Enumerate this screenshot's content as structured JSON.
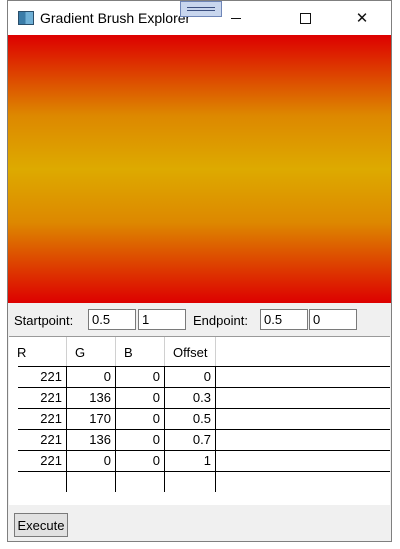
{
  "window": {
    "title": "Gradient Brush Explorer",
    "controls": {
      "minimize": "—",
      "maximize": "☐",
      "close": "✕"
    }
  },
  "gradient": {
    "stops": [
      {
        "color": "#dd0000",
        "offset": 0
      },
      {
        "color": "#dd8800",
        "offset": 0.3
      },
      {
        "color": "#ddaa00",
        "offset": 0.5
      },
      {
        "color": "#dd8800",
        "offset": 0.7
      },
      {
        "color": "#dd0000",
        "offset": 1
      }
    ]
  },
  "points": {
    "start_label": "Startpoint:",
    "start_x": "0.5",
    "start_y": "1",
    "end_label": "Endpoint:",
    "end_x": "0.5",
    "end_y": "0"
  },
  "grid": {
    "columns": [
      "R",
      "G",
      "B",
      "Offset"
    ],
    "rows": [
      [
        "221",
        "0",
        "0",
        "0"
      ],
      [
        "221",
        "136",
        "0",
        "0.3"
      ],
      [
        "221",
        "170",
        "0",
        "0.5"
      ],
      [
        "221",
        "136",
        "0",
        "0.7"
      ],
      [
        "221",
        "0",
        "0",
        "1"
      ],
      [
        "",
        "",
        "",
        ""
      ]
    ]
  },
  "actions": {
    "execute_label": "Execute"
  }
}
